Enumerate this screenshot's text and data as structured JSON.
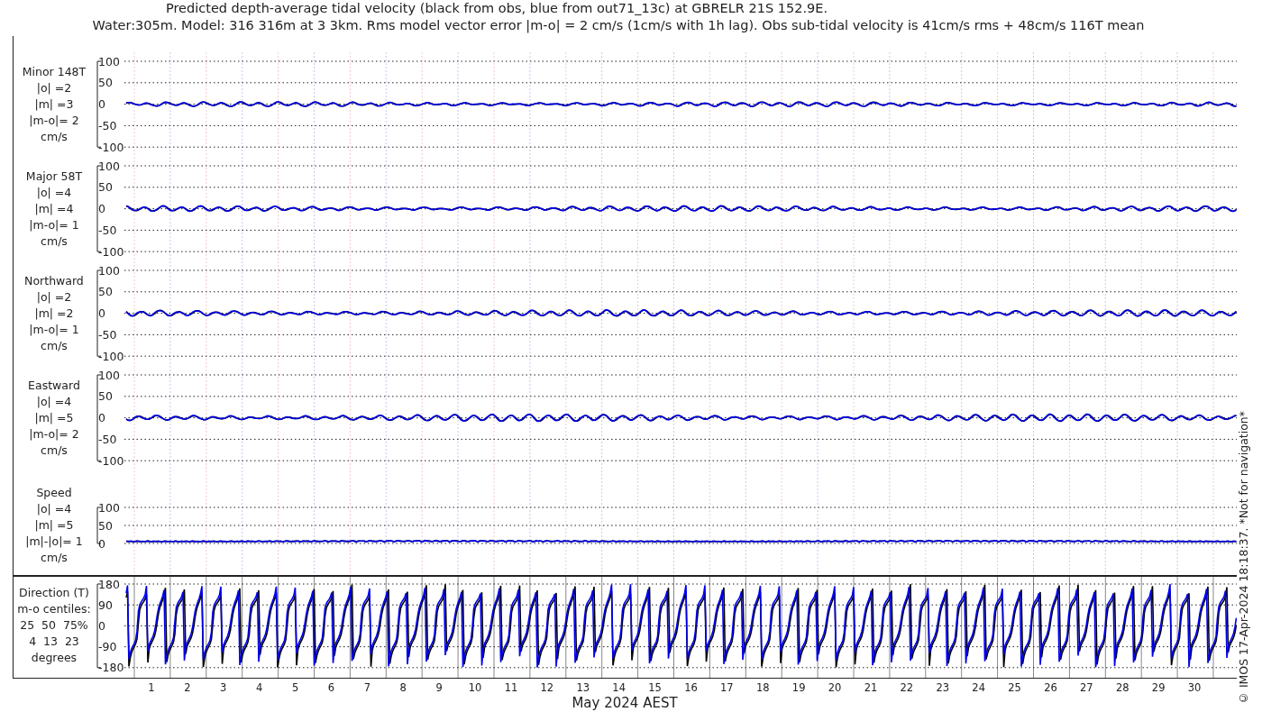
{
  "title": "Predicted depth-average tidal velocity (black from obs, blue from out71_13c) at GBRELR 21S 152.9E.",
  "subtitle": "Water:305m. Model: 316 316m at 3 3km. Rms model vector error |m-o| = 2 cm/s (1cm/s with 1h lag). Obs sub-tidal velocity is 41cm/s rms + 48cm/s 116T mean",
  "panels": [
    {
      "kind": "velocity",
      "label_lines": [
        "Minor 148T",
        "|o| =2",
        "|m| =3",
        "|m-o|= 2",
        "cm/s"
      ],
      "yticks": [
        "100",
        "50",
        "0",
        "-50",
        "-100"
      ]
    },
    {
      "kind": "velocity",
      "label_lines": [
        "Major 58T",
        "|o| =4",
        "|m| =4",
        "|m-o|= 1",
        "cm/s"
      ],
      "yticks": [
        "100",
        "50",
        "0",
        "-50",
        "-100"
      ]
    },
    {
      "kind": "velocity",
      "label_lines": [
        "Northward",
        "|o| =2",
        "|m| =2",
        "|m-o|= 1",
        "cm/s"
      ],
      "yticks": [
        "100",
        "50",
        "0",
        "-50",
        "-100"
      ]
    },
    {
      "kind": "velocity",
      "label_lines": [
        "Eastward",
        "|o| =4",
        "|m| =5",
        "|m-o|= 2",
        "cm/s"
      ],
      "yticks": [
        "100",
        "50",
        "0",
        "-50",
        "-100"
      ]
    },
    {
      "kind": "speed",
      "label_lines": [
        "Speed",
        "|o| =4",
        "|m| =5",
        "|m|-|o|= 1",
        "cm/s"
      ],
      "yticks": [
        "100",
        "50",
        "0"
      ]
    },
    {
      "kind": "direction",
      "label_lines": [
        "Direction (T)",
        "m-o centiles:",
        "25  50  75%",
        "4  13  23",
        "degrees"
      ],
      "yticks": [
        "180",
        "90",
        "0",
        "-90",
        "-180"
      ]
    }
  ],
  "x_axis": {
    "ticks": [
      "1",
      "2",
      "3",
      "4",
      "5",
      "6",
      "7",
      "8",
      "9",
      "10",
      "11",
      "12",
      "13",
      "14",
      "15",
      "16",
      "17",
      "18",
      "19",
      "20",
      "21",
      "22",
      "23",
      "24",
      "25",
      "26",
      "27",
      "28",
      "29",
      "30"
    ],
    "label": "May 2024 AEST"
  },
  "credit": "© IMOS 17-Apr-2024 18:18:37. *Not for navigation*"
}
